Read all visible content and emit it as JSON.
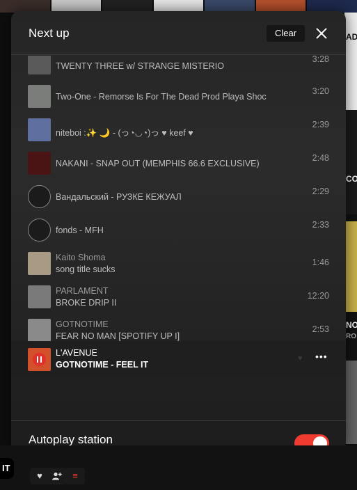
{
  "panel": {
    "title": "Next up",
    "clear_label": "Clear"
  },
  "queue": [
    {
      "title": "TWENTY THREE w/ STRANGE MISTERIO",
      "duration": "3:28",
      "art_color": "#5a5a5a"
    },
    {
      "title": "Two-One - Remorse Is For The Dead Prod Playa Shoc",
      "duration": "3:20",
      "art_color": "#7b7d7a"
    },
    {
      "title": "niteboi :✨ 🌙  - (っ◔◡◔)っ ♥ keef ♥",
      "duration": "2:39",
      "art_color": "#5f6fa0"
    },
    {
      "title": "NAKANI - SNAP OUT (MEMPHIS 66.6 EXCLUSIVE)",
      "duration": "2:48",
      "art_color": "#4a1414"
    },
    {
      "title": "Вандальский - РУЗКЕ КЕЖУАЛ",
      "duration": "2:29",
      "art_color": "#1b1b1b"
    },
    {
      "title": "fonds - MFH",
      "duration": "2:33",
      "art_color": "#1b1b1b"
    },
    {
      "artist": "Kaito Shoma",
      "title": "song title sucks",
      "duration": "1:46",
      "art_color": "#a89a84"
    },
    {
      "artist": "PARLAMENT",
      "title": "BROKE DRIP II",
      "duration": "12:20",
      "art_color": "#7a7a7a"
    },
    {
      "artist": "GOTNOTIME",
      "title": "FEAR NO MAN [SPOTIFY UP I]",
      "duration": "2:53",
      "art_color": "#8a8a8a"
    }
  ],
  "now_playing": {
    "artist": "L'AVENUE",
    "title": "GOTNOTIME - FEEL IT",
    "art_color": "#d2502a",
    "more_label": "•••"
  },
  "autoplay": {
    "label": "Autoplay station",
    "enabled": true
  },
  "background": {
    "right_strip_text": [
      "AD",
      "CO",
      "NO",
      "RO"
    ],
    "player_tag": "IT"
  },
  "player_controls": {
    "heart": "♥",
    "follow": "👤",
    "queue": "≡"
  },
  "colors": {
    "accent": "#ef3b30",
    "panel_bg": "#272727"
  }
}
